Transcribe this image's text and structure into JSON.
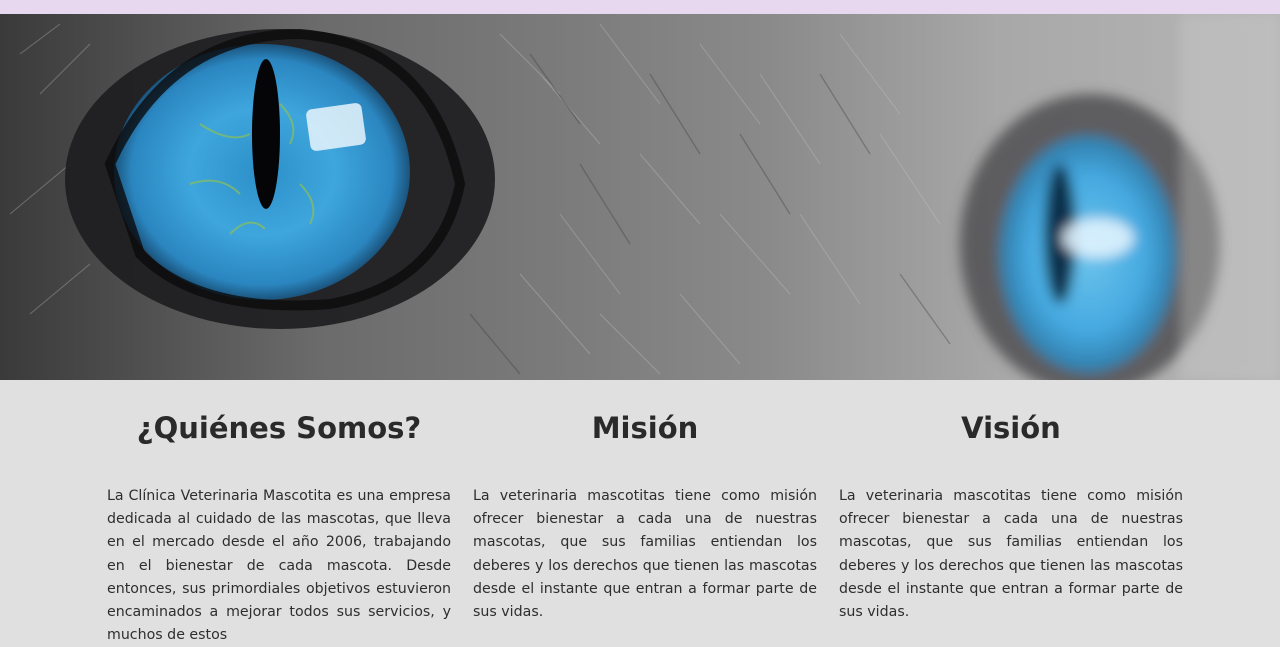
{
  "hero": {
    "image_description_icon": "cat-eyes-photo"
  },
  "about": {
    "title": "¿Quiénes Somos?",
    "text": "La Clínica Veterinaria Mascotita es una empresa dedicada al cuidado de las mascotas, que lleva en el mercado desde el año 2006, trabajando en el bienestar de cada mascota. Desde entonces, sus primordiales objetivos estuvieron encaminados a mejorar todos sus servicios, y muchos de estos"
  },
  "mission": {
    "title": "Misión",
    "text": "La veterinaria mascotitas tiene como misión ofrecer bienestar a cada una de nuestras mascotas, que sus familias entiendan los deberes y los derechos que tienen las mascotas desde el instante que entran a formar parte de sus vidas."
  },
  "vision": {
    "title": "Visión",
    "text": "La veterinaria mascotitas tiene como misión ofrecer bienestar a cada una de nuestras mascotas, que sus familias entiendan los deberes y los derechos que tienen las mascotas desde el instante que entran a formar parte de sus vidas."
  }
}
